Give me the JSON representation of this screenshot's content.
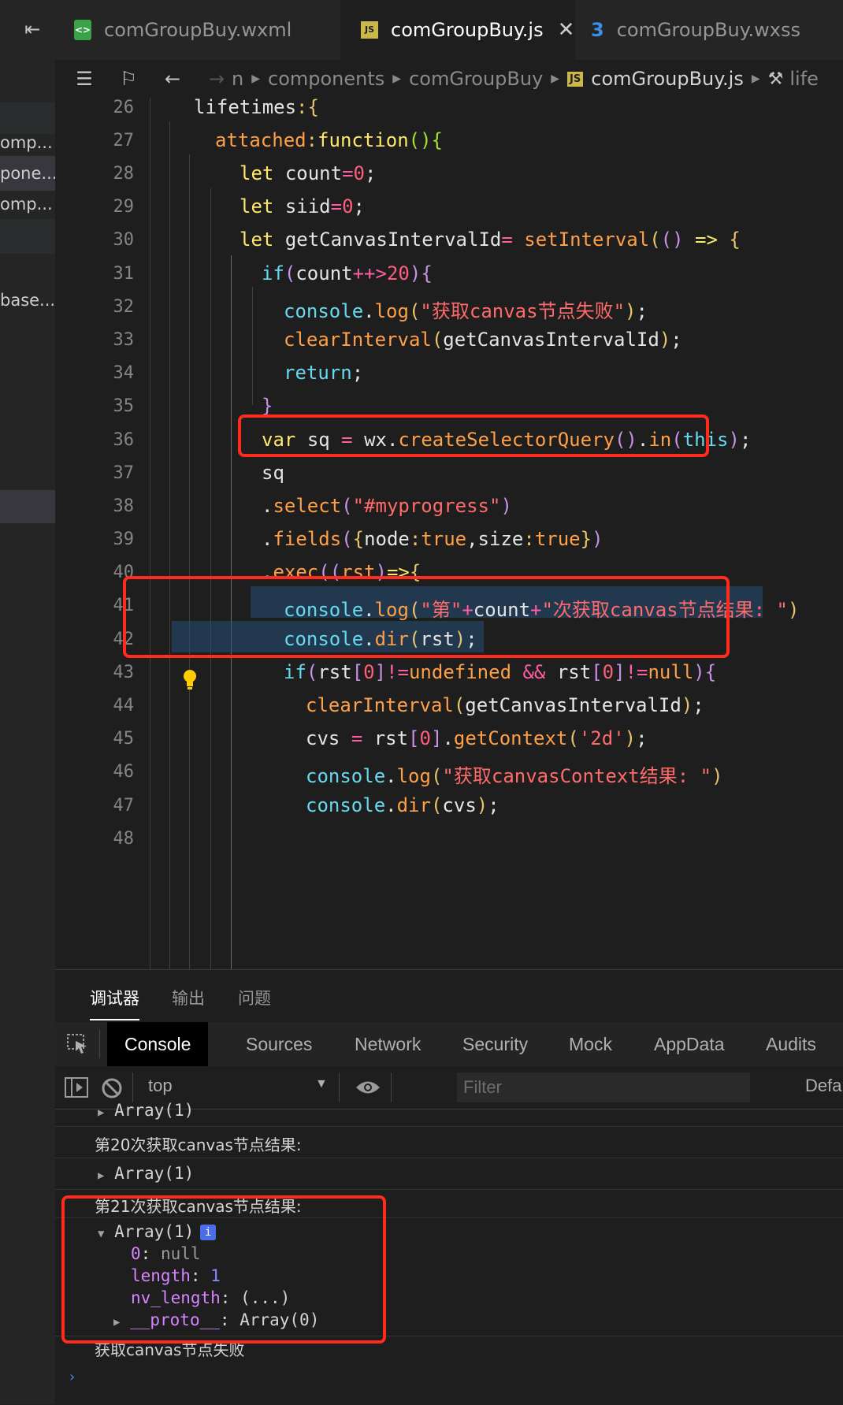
{
  "sidebar": {
    "items": [
      "omp...",
      "pone...",
      "omp...",
      "base..."
    ]
  },
  "tabs": [
    {
      "label": "comGroupBuy.wxml",
      "icon": "wxml-file-icon",
      "active": false
    },
    {
      "label": "comGroupBuy.js",
      "icon": "js-file-icon",
      "active": true
    },
    {
      "label": "comGroupBuy.wxss",
      "icon": "css-file-icon",
      "active": false
    }
  ],
  "tab_icons": {
    "wxml": "<>",
    "js": "JS",
    "css": "3"
  },
  "breadcrumb": {
    "prefix": "n",
    "items": [
      "components",
      "comGroupBuy",
      "comGroupBuy.js",
      "life"
    ]
  },
  "editor": {
    "line_numbers": [
      "26",
      "27",
      "28",
      "29",
      "30",
      "31",
      "32",
      "33",
      "34",
      "35",
      "36",
      "37",
      "38",
      "39",
      "40",
      "41",
      "42",
      "43",
      "44",
      "45",
      "46",
      "47",
      "48"
    ]
  },
  "panel": {
    "tabs": [
      "调试器",
      "输出",
      "问题"
    ],
    "devtools_tabs": [
      "Console",
      "Sources",
      "Network",
      "Security",
      "Mock",
      "AppData",
      "Audits"
    ],
    "context": "top",
    "filter_placeholder": "Filter",
    "default_levels": "Defa"
  },
  "console": {
    "partial_top": "Array(1)",
    "msg20": "第20次获取canvas节点结果:",
    "arr20": "Array(1)",
    "msg21": "第21次获取canvas节点结果:",
    "arr21": "Array(1)",
    "info_badge": "i",
    "entries": [
      {
        "key": "0",
        "value": "null"
      },
      {
        "key": "length",
        "value": "1"
      },
      {
        "key": "nv_length",
        "value": "(...)"
      },
      {
        "key": "__proto__",
        "value": "Array(0)"
      }
    ],
    "fail": "获取canvas节点失败"
  }
}
